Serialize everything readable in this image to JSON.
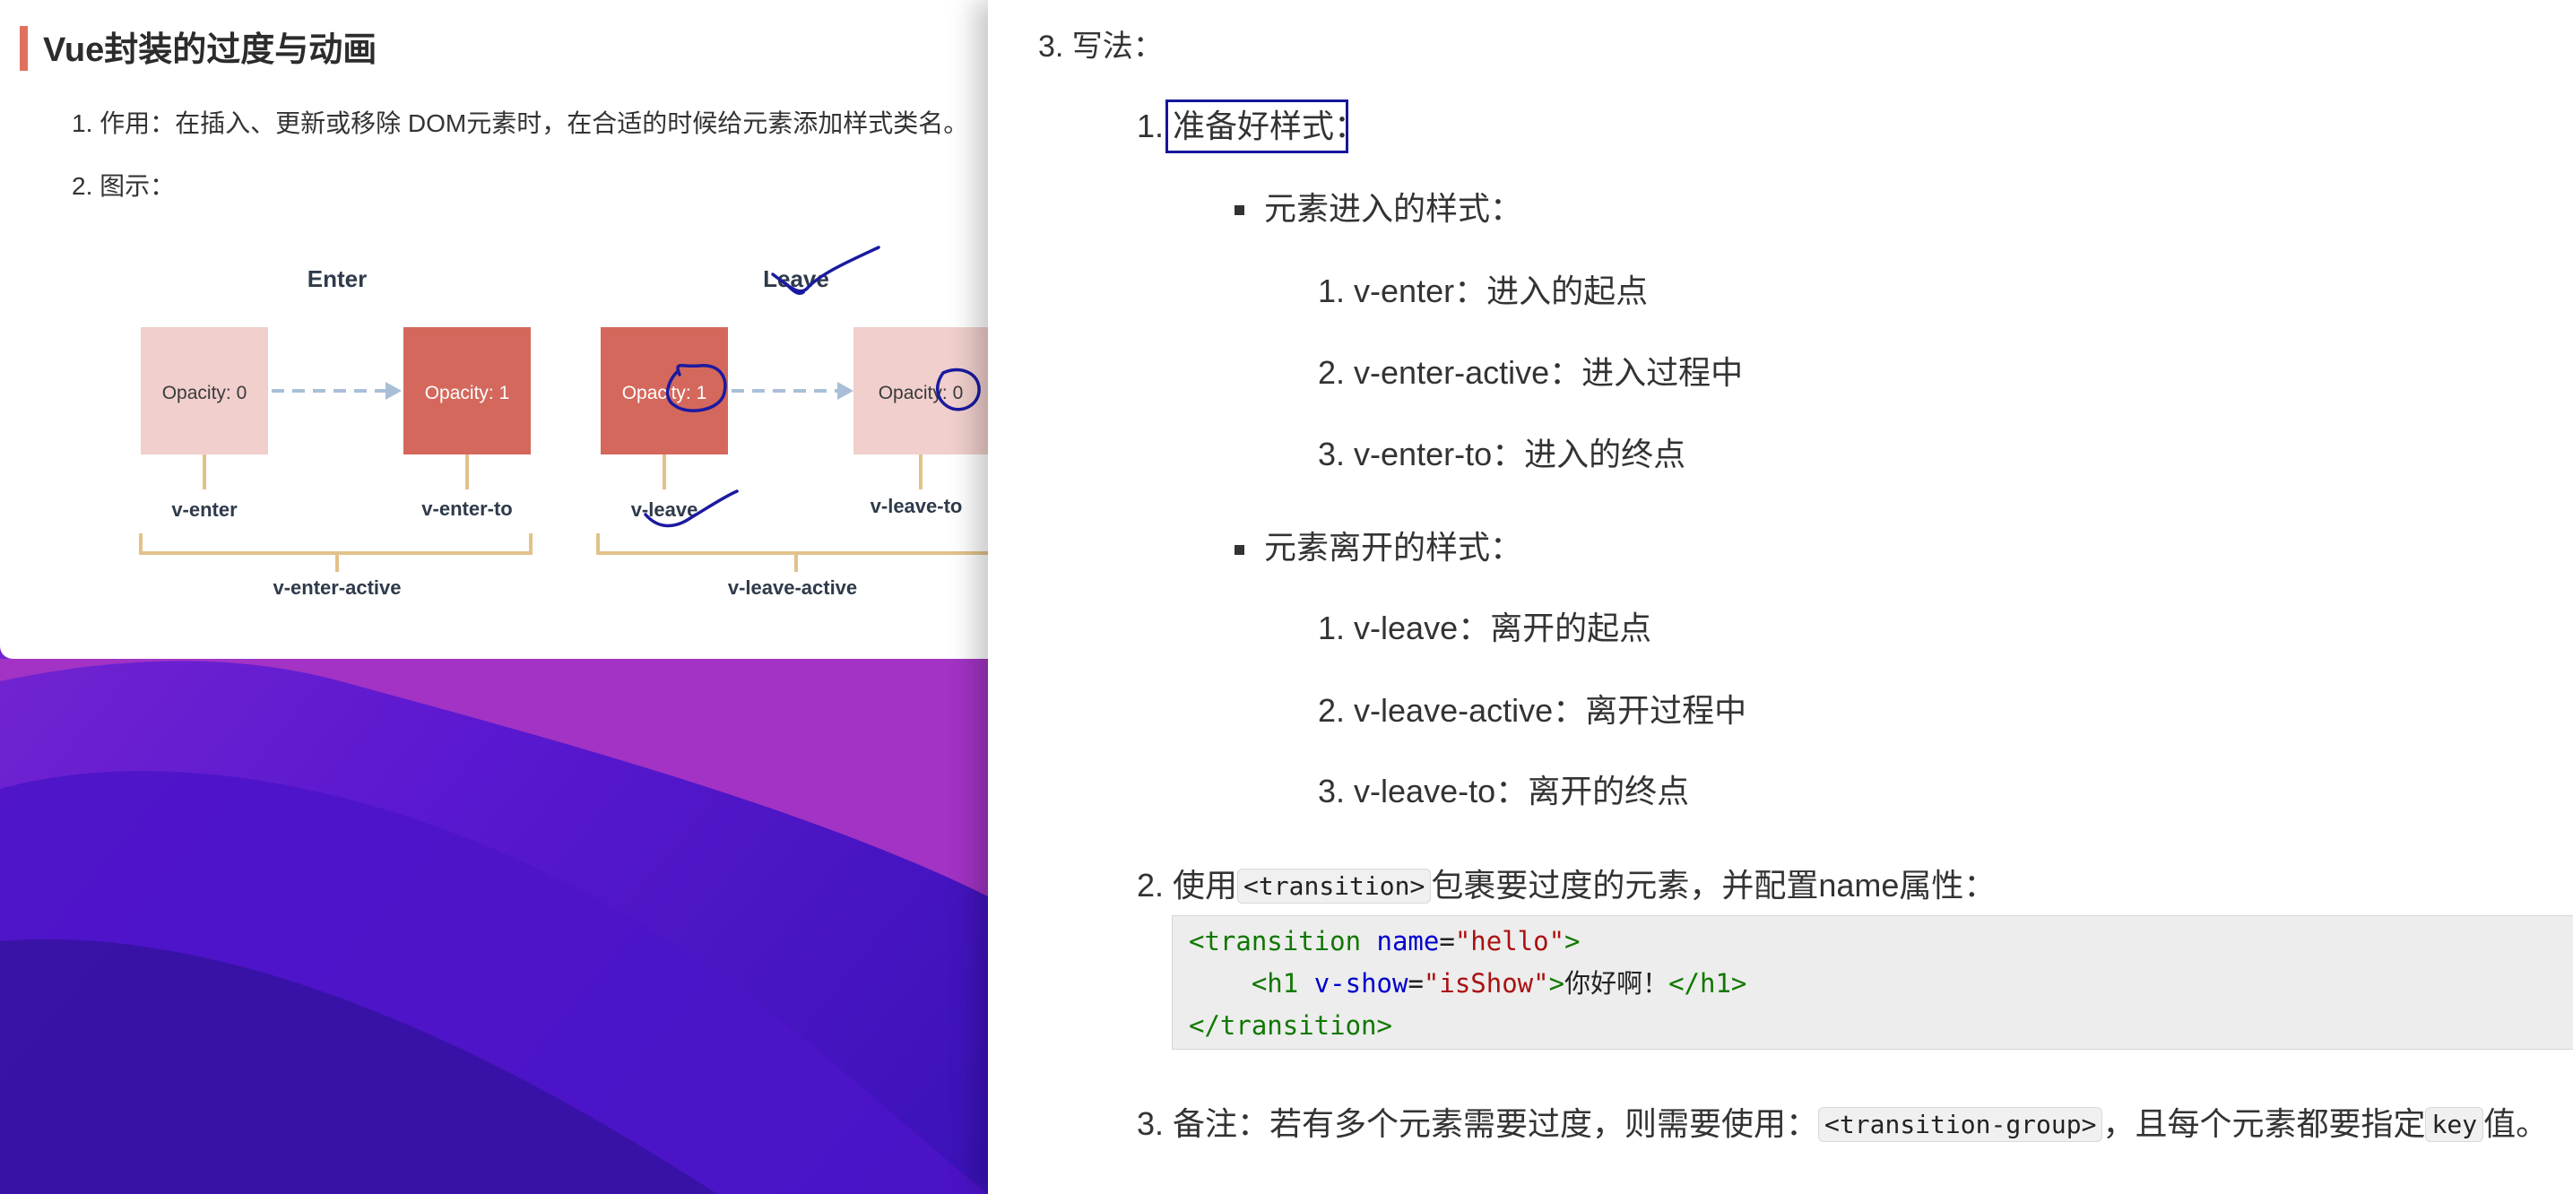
{
  "left_doc": {
    "title": "Vue封装的过度与动画",
    "item1_number": "1.",
    "item1_text": "作用：在插入、更新或移除 DOM元素时，在合适的时候给元素添加样式类名。",
    "item2_number": "2.",
    "item2_text": "图示：",
    "diagram": {
      "enter_heading": "Enter",
      "leave_heading": "Leave",
      "boxes": [
        "Opacity: 0",
        "Opacity: 1",
        "Opacity: 1",
        "Opacity: 0"
      ],
      "labels": [
        "v-enter",
        "v-enter-to",
        "v-leave",
        "v-leave-to"
      ],
      "group_labels": [
        "v-enter-active",
        "v-leave-active"
      ],
      "colors": {
        "light_box": "#f0cfcc",
        "dark_box": "#d4685c",
        "bracket": "#e2c28a",
        "arrow": "#a9bfd8"
      }
    }
  },
  "right_doc": {
    "section_heading": "3. 写法：",
    "step1_number": "1.",
    "step1_text": "准备好样式：",
    "enter_styles_heading": "元素进入的样式：",
    "enter_styles": [
      {
        "num": "1.",
        "text": "v-enter：进入的起点"
      },
      {
        "num": "2.",
        "text": "v-enter-active：进入过程中"
      },
      {
        "num": "3.",
        "text": "v-enter-to：进入的终点"
      }
    ],
    "leave_styles_heading": "元素离开的样式：",
    "leave_styles": [
      {
        "num": "1.",
        "text": "v-leave：离开的起点"
      },
      {
        "num": "2.",
        "text": "v-leave-active：离开过程中"
      },
      {
        "num": "3.",
        "text": "v-leave-to：离开的终点"
      }
    ],
    "step2_prefix": "2. 使用",
    "step2_code": "<transition>",
    "step2_suffix": "包裹要过度的元素，并配置name属性：",
    "code": {
      "l1_open": "<transition ",
      "l1_attr": "name",
      "l1_eq": "=",
      "l1_val": "\"hello\"",
      "l1_close": ">",
      "l2_indent": "    ",
      "l2_open": "<h1 ",
      "l2_attr": "v-show",
      "l2_eq": "=",
      "l2_val": "\"isShow\"",
      "l2_close": ">",
      "l2_text": "你好啊！",
      "l2_end": "</h1>",
      "l3": "</transition>"
    },
    "step3_prefix": "3. 备注：若有多个元素需要过度，则需要使用：",
    "step3_code1": "<transition-group>",
    "step3_mid": "，且每个元素都要指定",
    "step3_code2": "key",
    "step3_suffix": "值。"
  },
  "colors": {
    "title_accent": "#e0715e",
    "highlight_box": "#15169a",
    "ink": "#1a1aa0",
    "wallpaper_light": "#9a2fc0",
    "wallpaper_dark": "#3a18a8"
  }
}
